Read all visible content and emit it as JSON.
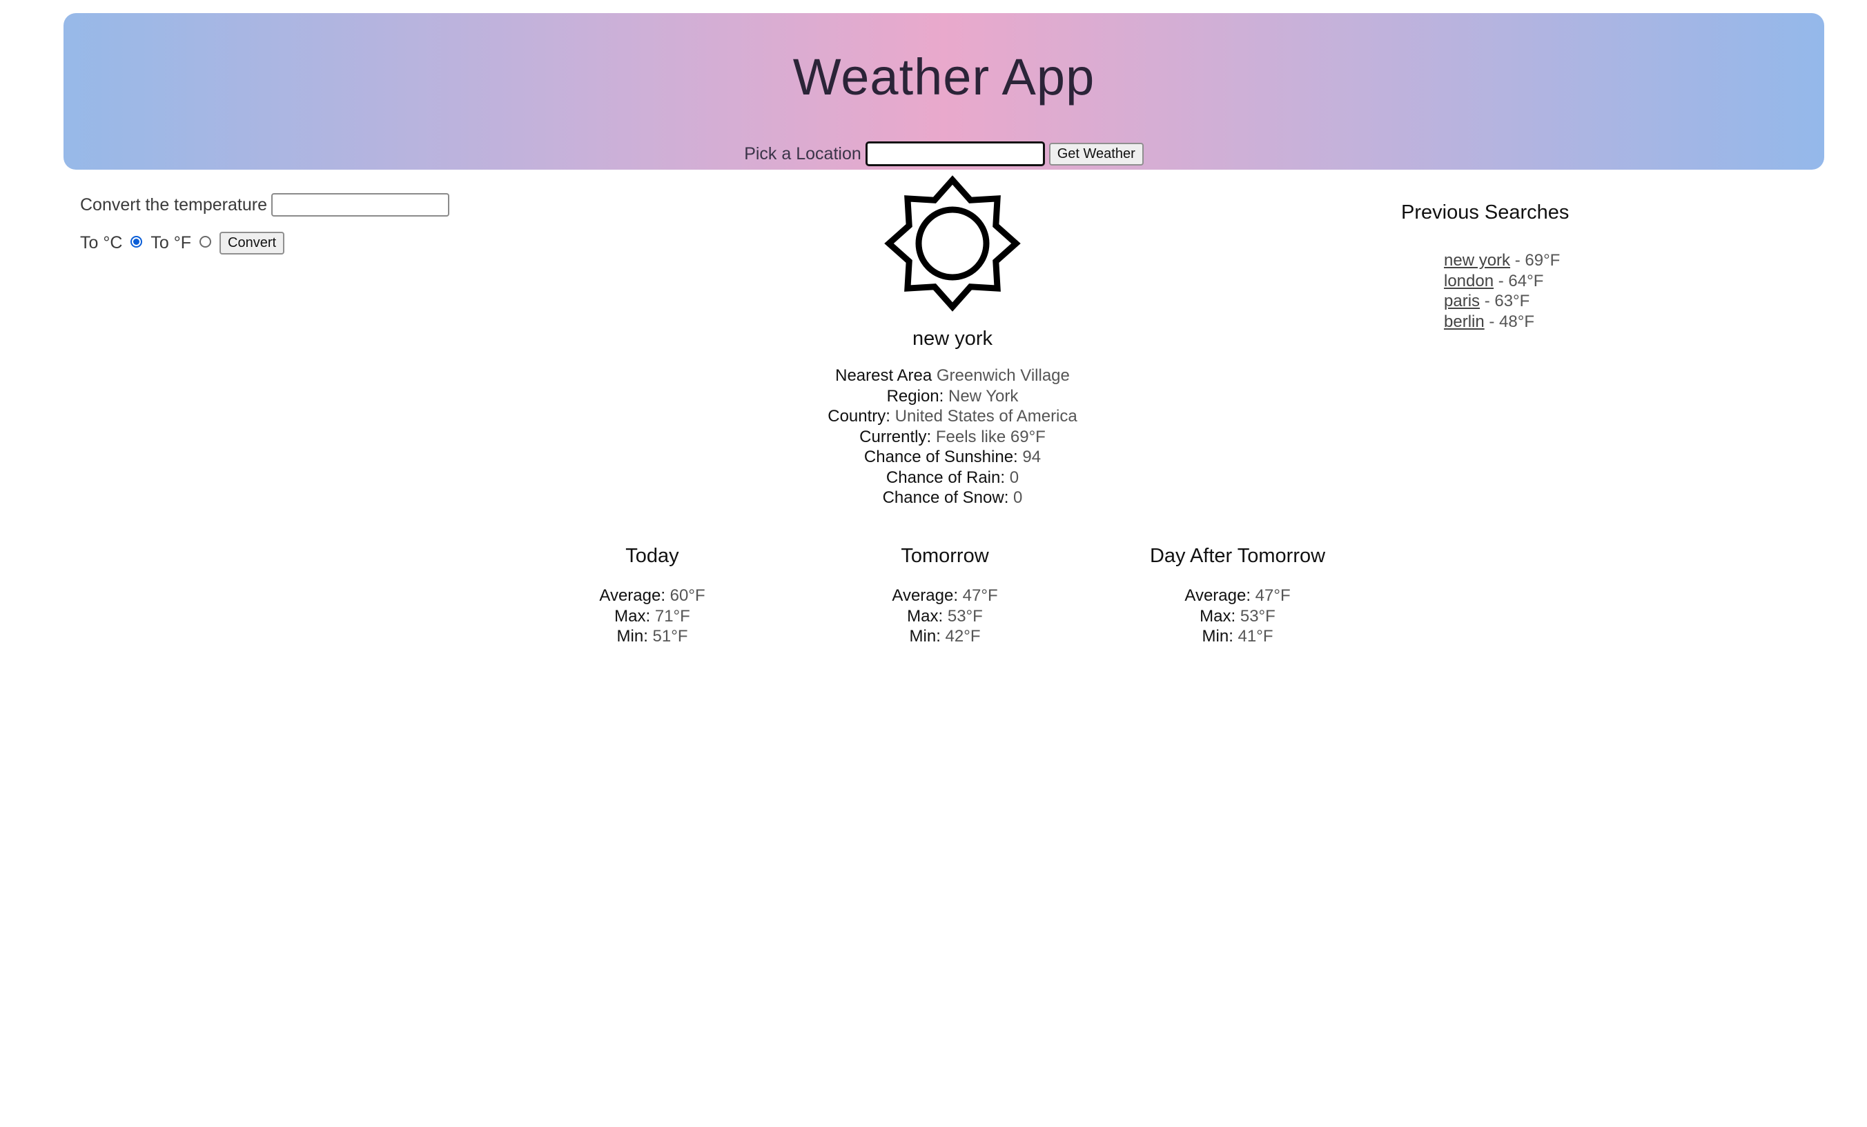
{
  "header": {
    "title": "Weather App",
    "location_label": "Pick a Location",
    "location_value": "",
    "get_weather_label": "Get Weather"
  },
  "converter": {
    "label": "Convert the temperature",
    "value": "",
    "to_c_label": "To °C",
    "to_f_label": "To °F",
    "selected": "To °C",
    "convert_label": "Convert"
  },
  "current": {
    "icon": "sun-icon",
    "city": "new york",
    "details": [
      {
        "key": "Nearest Area",
        "value": "Greenwich Village"
      },
      {
        "key": "Region:",
        "value": "New York"
      },
      {
        "key": "Country:",
        "value": "United States of America"
      },
      {
        "key": "Currently:",
        "value": "Feels like 69°F"
      },
      {
        "key": "Chance of Sunshine:",
        "value": "94"
      },
      {
        "key": "Chance of Rain:",
        "value": "0"
      },
      {
        "key": "Chance of Snow:",
        "value": "0"
      }
    ]
  },
  "forecast": [
    {
      "title": "Today",
      "average_label": "Average:",
      "average": "60°F",
      "max_label": "Max:",
      "max": "71°F",
      "min_label": "Min:",
      "min": "51°F"
    },
    {
      "title": "Tomorrow",
      "average_label": "Average:",
      "average": "47°F",
      "max_label": "Max:",
      "max": "53°F",
      "min_label": "Min:",
      "min": "42°F"
    },
    {
      "title": "Day After Tomorrow",
      "average_label": "Average:",
      "average": "47°F",
      "max_label": "Max:",
      "max": "53°F",
      "min_label": "Min:",
      "min": "41°F"
    }
  ],
  "previous": {
    "title": "Previous Searches",
    "items": [
      {
        "city": "new york",
        "temp": " - 69°F"
      },
      {
        "city": "london",
        "temp": " - 64°F"
      },
      {
        "city": "paris",
        "temp": " - 63°F"
      },
      {
        "city": "berlin",
        "temp": " - 48°F"
      }
    ]
  },
  "colors": {
    "header_gradient": [
      "#97b9e8",
      "#e9a9cc",
      "#94b8ea"
    ],
    "radio_accent": "#0b5ed7"
  }
}
